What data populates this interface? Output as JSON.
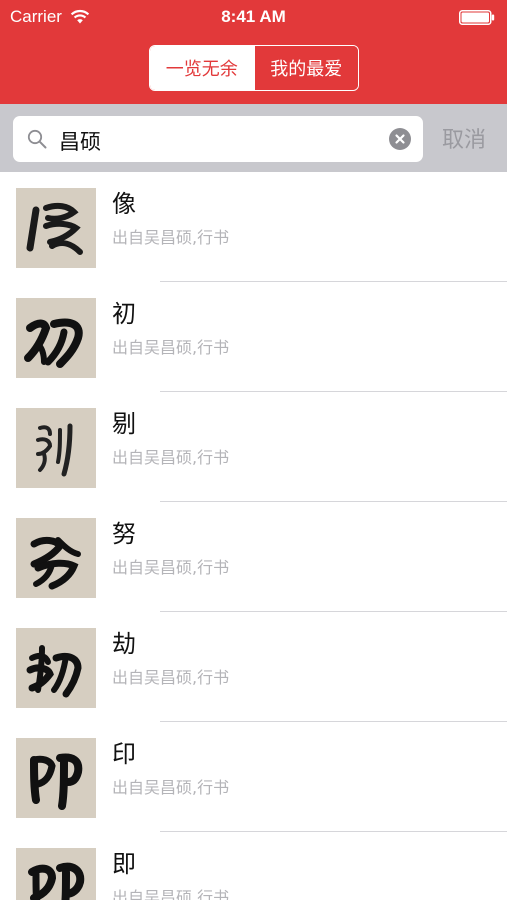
{
  "status_bar": {
    "carrier": "Carrier",
    "time": "8:41 AM",
    "wifi_icon": "wifi-icon",
    "battery_icon": "battery-icon"
  },
  "header": {
    "segments": [
      "一览无余",
      "我的最爱"
    ],
    "selected_segment": 0,
    "bg_color": "#e2393a"
  },
  "search": {
    "value": "昌硕",
    "cancel_label": "取消",
    "search_icon": "search-icon",
    "clear_icon": "clear-icon"
  },
  "results": [
    {
      "character": "像",
      "source": "出自吴昌硕,行书"
    },
    {
      "character": "初",
      "source": "出自吴昌硕,行书"
    },
    {
      "character": "剔",
      "source": "出自吴昌硕,行书"
    },
    {
      "character": "努",
      "source": "出自吴昌硕,行书"
    },
    {
      "character": "劫",
      "source": "出自吴昌硕,行书"
    },
    {
      "character": "印",
      "source": "出自吴昌硕,行书"
    },
    {
      "character": "即",
      "source": "出自吴昌硕,行书"
    }
  ]
}
